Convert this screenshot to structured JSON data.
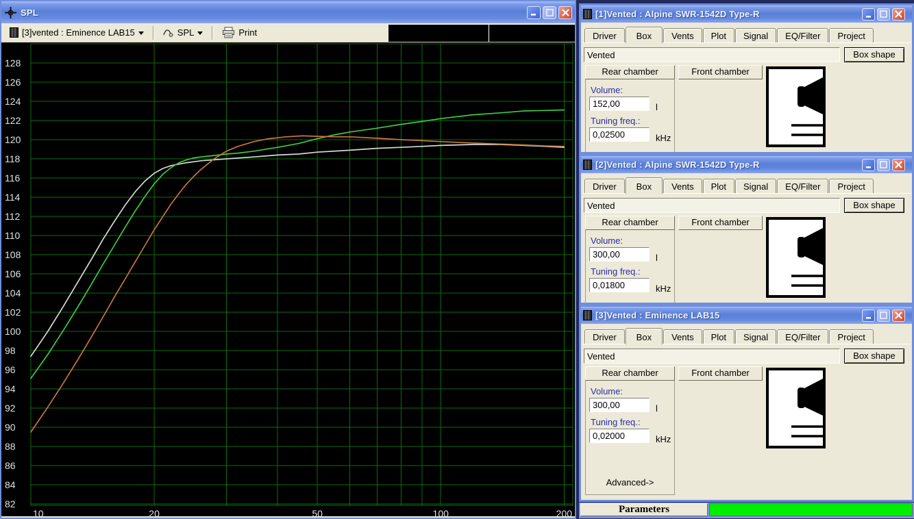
{
  "app_background": "#232a5c",
  "spl_window": {
    "title": "SPL",
    "toolbar": {
      "source_selector": "[3]vented : Eminence LAB15",
      "graph_selector": "SPL",
      "print_label": "Print"
    }
  },
  "chart_data": {
    "type": "line",
    "title": "SPL",
    "xlabel": "",
    "ylabel": "",
    "x_scale": "log",
    "xlim": [
      10,
      210
    ],
    "ylim": [
      82,
      128
    ],
    "y_tick_step": 2,
    "x_ticks": [
      10,
      20,
      50,
      100,
      200
    ],
    "x_gridlines": [
      20,
      30,
      40,
      50,
      60,
      70,
      80,
      90,
      100,
      200
    ],
    "grid_on": true,
    "legend": "none",
    "bg_color": "#000000",
    "grid_color": "#0c6e0c",
    "tick_color": "#e2e2e2",
    "series": [
      {
        "name": "white-curve",
        "color": "#d8d8d8",
        "points": [
          [
            10,
            97.4
          ],
          [
            11,
            100.0
          ],
          [
            12,
            102.6
          ],
          [
            13,
            105.1
          ],
          [
            14,
            107.4
          ],
          [
            15,
            109.6
          ],
          [
            16,
            111.5
          ],
          [
            17,
            113.2
          ],
          [
            18,
            114.6
          ],
          [
            19,
            115.7
          ],
          [
            20,
            116.5
          ],
          [
            21,
            117.0
          ],
          [
            22,
            117.3
          ],
          [
            24,
            117.6
          ],
          [
            26,
            117.8
          ],
          [
            28,
            117.9
          ],
          [
            30,
            118.0
          ],
          [
            35,
            118.2
          ],
          [
            40,
            118.4
          ],
          [
            45,
            118.5
          ],
          [
            50,
            118.7
          ],
          [
            60,
            118.9
          ],
          [
            70,
            119.1
          ],
          [
            80,
            119.2
          ],
          [
            90,
            119.3
          ],
          [
            100,
            119.4
          ],
          [
            120,
            119.5
          ],
          [
            140,
            119.5
          ],
          [
            160,
            119.4
          ],
          [
            180,
            119.3
          ],
          [
            200,
            119.2
          ]
        ]
      },
      {
        "name": "green-curve",
        "color": "#3ecb3e",
        "points": [
          [
            10,
            95.1
          ],
          [
            11,
            97.6
          ],
          [
            12,
            100.1
          ],
          [
            13,
            102.5
          ],
          [
            14,
            104.8
          ],
          [
            15,
            107.0
          ],
          [
            16,
            109.0
          ],
          [
            17,
            110.9
          ],
          [
            18,
            112.6
          ],
          [
            19,
            114.1
          ],
          [
            20,
            115.4
          ],
          [
            21,
            116.4
          ],
          [
            22,
            117.1
          ],
          [
            23,
            117.6
          ],
          [
            24,
            117.9
          ],
          [
            25,
            118.1
          ],
          [
            26,
            118.2
          ],
          [
            28,
            118.35
          ],
          [
            30,
            118.5
          ],
          [
            32,
            118.6
          ],
          [
            35,
            118.8
          ],
          [
            40,
            119.2
          ],
          [
            45,
            119.6
          ],
          [
            50,
            120.1
          ],
          [
            55,
            120.5
          ],
          [
            60,
            120.8
          ],
          [
            70,
            121.2
          ],
          [
            80,
            121.6
          ],
          [
            90,
            121.9
          ],
          [
            100,
            122.2
          ],
          [
            120,
            122.6
          ],
          [
            140,
            122.8
          ],
          [
            160,
            123.0
          ],
          [
            180,
            123.05
          ],
          [
            200,
            123.1
          ]
        ]
      },
      {
        "name": "orange-curve",
        "color": "#c8763c",
        "points": [
          [
            10,
            89.5
          ],
          [
            11,
            92.1
          ],
          [
            12,
            94.6
          ],
          [
            13,
            97.0
          ],
          [
            14,
            99.3
          ],
          [
            15,
            101.5
          ],
          [
            16,
            103.6
          ],
          [
            17,
            105.5
          ],
          [
            18,
            107.3
          ],
          [
            19,
            109.0
          ],
          [
            20,
            110.6
          ],
          [
            21,
            112.0
          ],
          [
            22,
            113.3
          ],
          [
            23,
            114.4
          ],
          [
            24,
            115.4
          ],
          [
            25,
            116.2
          ],
          [
            26,
            116.9
          ],
          [
            28,
            118.0
          ],
          [
            30,
            118.8
          ],
          [
            32,
            119.3
          ],
          [
            35,
            119.8
          ],
          [
            38,
            120.1
          ],
          [
            42,
            120.3
          ],
          [
            46,
            120.4
          ],
          [
            50,
            120.35
          ],
          [
            55,
            120.3
          ],
          [
            60,
            120.3
          ],
          [
            70,
            120.15
          ],
          [
            80,
            120.0
          ],
          [
            90,
            119.9
          ],
          [
            100,
            119.8
          ],
          [
            120,
            119.65
          ],
          [
            140,
            119.55
          ],
          [
            160,
            119.45
          ],
          [
            180,
            119.35
          ],
          [
            200,
            119.3
          ]
        ]
      }
    ]
  },
  "windows": [
    {
      "title": "[1]Vented : Alpine SWR-1542D Type-R",
      "tabs": [
        "Driver",
        "Box",
        "Vents",
        "Plot",
        "Signal",
        "EQ/Filter",
        "Project"
      ],
      "active_tab": "Box",
      "box_type": "Vented",
      "box_shape_label": "Box shape",
      "rear_chamber_label": "Rear chamber",
      "front_chamber_label": "Front chamber",
      "volume_label": "Volume:",
      "volume_value": "152,00",
      "volume_unit": "l",
      "tuning_label": "Tuning freq.:",
      "tuning_value": "0,02500",
      "tuning_unit": "kHz"
    },
    {
      "title": "[2]Vented : Alpine SWR-1542D Type-R",
      "tabs": [
        "Driver",
        "Box",
        "Vents",
        "Plot",
        "Signal",
        "EQ/Filter",
        "Project"
      ],
      "active_tab": "Box",
      "box_type": "Vented",
      "box_shape_label": "Box shape",
      "rear_chamber_label": "Rear chamber",
      "front_chamber_label": "Front chamber",
      "volume_label": "Volume:",
      "volume_value": "300,00",
      "volume_unit": "l",
      "tuning_label": "Tuning freq.:",
      "tuning_value": "0,01800",
      "tuning_unit": "kHz"
    },
    {
      "title": "[3]Vented : Eminence LAB15",
      "tabs": [
        "Driver",
        "Box",
        "Vents",
        "Plot",
        "Signal",
        "EQ/Filter",
        "Project"
      ],
      "active_tab": "Box",
      "box_type": "Vented",
      "box_shape_label": "Box shape",
      "rear_chamber_label": "Rear chamber",
      "front_chamber_label": "Front chamber",
      "volume_label": "Volume:",
      "volume_value": "300,00",
      "volume_unit": "l",
      "tuning_label": "Tuning freq.:",
      "tuning_value": "0,02000",
      "tuning_unit": "kHz",
      "advanced_label": "Advanced->"
    }
  ],
  "status_bar": {
    "label": "Parameters",
    "progress_percent": 100,
    "progress_color": "#00ee00"
  }
}
